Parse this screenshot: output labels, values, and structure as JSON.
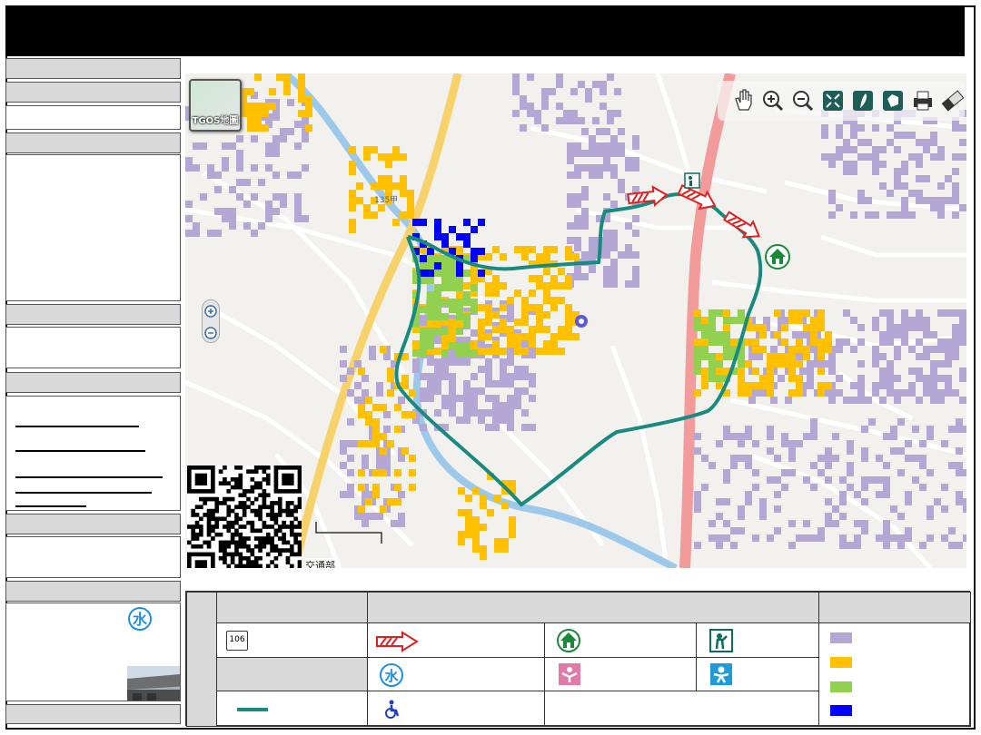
{
  "map": {
    "badge_text": "TGOS地圖",
    "road_label": "135甲",
    "credit": "交通部"
  },
  "toolbar": {
    "items": [
      "pan-hand-icon",
      "zoom-in-icon",
      "zoom-out-icon",
      "full-extent-icon",
      "taiwan-icon",
      "polygon-icon",
      "print-icon",
      "eraser-icon"
    ]
  },
  "legend": {
    "route_sign": "106",
    "water_symbol": "水"
  },
  "colors": {
    "title_bg": "#000000",
    "header_grey": "#d9d9d9",
    "flood_level_1": "#b4a7d6",
    "flood_level_2": "#ffc000",
    "flood_level_3": "#92d050",
    "flood_level_4": "#0000ff",
    "route": "#188a80",
    "highway": "#f39a9a",
    "river": "#9cc9ea",
    "arterial": "#f7d26a"
  }
}
